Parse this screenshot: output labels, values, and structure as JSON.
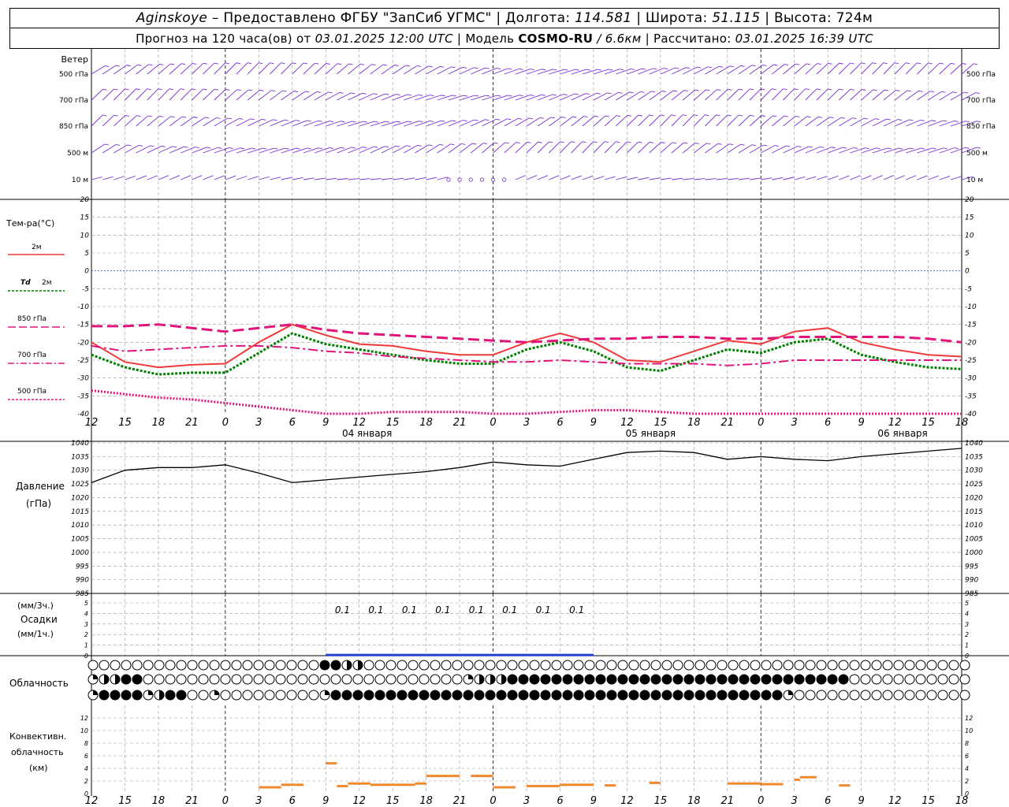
{
  "header": {
    "line1": {
      "station": "Aginskoye",
      "provider": " – Предоставлено ФГБУ \"ЗапСиб УГМС\" | Долгота: ",
      "lon": "114.581",
      "lat_label": " | Широта: ",
      "lat": "51.115",
      "alt_label": " | Высота: ",
      "alt": "724м"
    },
    "line2": {
      "forecast_label": "Прогноз на 120 часа(ов) от ",
      "forecast_from": "03.01.2025 12:00 UTC",
      "model_label": " | Модель ",
      "model": "COSMO-RU",
      "resolution": " / 6.6км",
      "calc_label": " | Рассчитано: ",
      "calc_time": "03.01.2025 16:39 UTC"
    }
  },
  "colors": {
    "wind": "#7a2ed6",
    "t2m": "#f03a3a",
    "td2m": "#008000",
    "t850": "#e0157a",
    "t700": "#e0157a",
    "t500": "#e0157a",
    "zero_line": "#3050e0",
    "pressure": "#000000",
    "precip": "#2040d0",
    "convective": "#f08a30",
    "grid": "#9a9a9a"
  },
  "labels": {
    "wind_title": "Ветер",
    "wind_levels": [
      "500 гПа",
      "700 гПа",
      "850 гПа",
      "500 м",
      "10 м"
    ],
    "temp_title": "Тем-ра(°C)",
    "t2m_label": "2м",
    "td_label": "Td",
    "td_level": "2м",
    "t850_label": "850 гПа",
    "t700_label": "700 гПа",
    "t500_label": "500 гПа",
    "pressure_title": "Давление",
    "pressure_unit": "(гПа)",
    "precip_unit_3h": "(мм/3ч.)",
    "precip_title": "Осадки",
    "precip_unit_1h": "(мм/1ч.)",
    "cloud_title": "Облачность",
    "conv_title1": "Конвективн.",
    "conv_title2": "облачность",
    "conv_unit": "(км)"
  },
  "time_axis": {
    "ticks": [
      "12",
      "15",
      "18",
      "21",
      "0",
      "3",
      "6",
      "9",
      "12",
      "15",
      "18",
      "21",
      "0",
      "3",
      "6",
      "9",
      "12",
      "15",
      "18",
      "21",
      "0",
      "3",
      "6",
      "9",
      "12",
      "15",
      "18"
    ],
    "dates": [
      "04 января",
      "05 января",
      "06 января"
    ]
  },
  "chart_data": [
    {
      "type": "line",
      "title": "Тем-ра(°C)",
      "ylim": [
        -40,
        20
      ],
      "yticks": [
        "20",
        "15",
        "10",
        "5",
        "0",
        "-5",
        "-10",
        "-15",
        "-20",
        "-25",
        "-30",
        "-35",
        "-40"
      ],
      "x_hours": [
        0,
        3,
        6,
        9,
        12,
        15,
        18,
        21,
        24,
        27,
        30,
        33,
        36,
        39,
        42,
        45,
        48,
        51,
        54,
        57,
        60,
        63,
        66,
        69,
        72,
        75,
        78
      ],
      "series": [
        {
          "name": "2м",
          "values": [
            -20,
            -25.5,
            -27,
            -26.3,
            -26,
            -20,
            -15,
            -18,
            -20.5,
            -21,
            -22.5,
            -23.5,
            -23.5,
            -20,
            -17.5,
            -20,
            -25,
            -25.5,
            -22.5,
            -19.5,
            -20.5,
            -17,
            -16,
            -20,
            -22,
            -23.5,
            -24
          ]
        },
        {
          "name": "Td 2м",
          "values": [
            -23.5,
            -27,
            -29,
            -28.5,
            -28.5,
            -23,
            -17.5,
            -20.5,
            -22,
            -23.5,
            -25,
            -26,
            -26,
            -22,
            -20,
            -22.5,
            -27,
            -28,
            -25,
            -22,
            -23,
            -20,
            -19,
            -23.5,
            -25.5,
            -27,
            -27.5
          ]
        },
        {
          "name": "850 гПа",
          "values": [
            -15.5,
            -15.5,
            -15,
            -16,
            -17,
            -16,
            -15,
            -16.5,
            -17.5,
            -18,
            -18.5,
            -19,
            -19.5,
            -20,
            -19.5,
            -19,
            -19,
            -18.5,
            -18.5,
            -19,
            -19,
            -18.5,
            -18.5,
            -18.5,
            -18.5,
            -19,
            -20
          ]
        },
        {
          "name": "700 гПа",
          "values": [
            -21,
            -22.5,
            -22,
            -21.5,
            -21,
            -21,
            -21.5,
            -22.5,
            -23,
            -24,
            -24.5,
            -25,
            -25.5,
            -25.5,
            -25,
            -25.5,
            -26,
            -26,
            -26,
            -26.5,
            -26,
            -25,
            -25,
            -25,
            -25,
            -25,
            -25
          ]
        },
        {
          "name": "500 гПа",
          "values": [
            -33.5,
            -34.5,
            -35.5,
            -36,
            -37,
            -38,
            -39,
            -40,
            -40,
            -39.5,
            -39.5,
            -39.5,
            -40,
            -40,
            -39.5,
            -39,
            -39,
            -39.5,
            -40,
            -40.5,
            -40,
            -40,
            -40.5,
            -41,
            -41,
            -41,
            -41
          ]
        }
      ]
    },
    {
      "type": "line",
      "title": "Давление",
      "ylabel": "(гПа)",
      "ylim": [
        985,
        1040
      ],
      "yticks": [
        "1040",
        "1035",
        "1030",
        "1025",
        "1020",
        "1015",
        "1010",
        "1005",
        "1000",
        "995",
        "990",
        "985"
      ],
      "x_hours": [
        0,
        3,
        6,
        9,
        12,
        15,
        18,
        21,
        24,
        27,
        30,
        33,
        36,
        39,
        42,
        45,
        48,
        51,
        54,
        57,
        60,
        63,
        66,
        69,
        72,
        75,
        78
      ],
      "series": [
        {
          "name": "Давление",
          "values": [
            1025.5,
            1030,
            1031,
            1031,
            1032,
            1029,
            1025.5,
            1026.5,
            1027.5,
            1028.5,
            1029.5,
            1031,
            1033,
            1032,
            1031.5,
            1034,
            1036.5,
            1037,
            1036.5,
            1034,
            1035,
            1034,
            1033.5,
            1035,
            1036,
            1037,
            1038
          ]
        }
      ]
    },
    {
      "type": "bar",
      "title": "Осадки",
      "ylim": [
        0,
        5
      ],
      "yticks": [
        "5",
        "4",
        "3",
        "2",
        "1",
        "0"
      ],
      "amount_labels": [
        "0.1",
        "0.1",
        "0.1",
        "0.1",
        "0.1",
        "0.1",
        "0.1",
        "0.1"
      ],
      "x_hours": [
        21,
        24,
        27,
        30,
        33,
        36,
        39,
        42
      ],
      "values": [
        0.1,
        0.1,
        0.1,
        0.1,
        0.1,
        0.1,
        0.1,
        0.1
      ]
    },
    {
      "type": "table",
      "title": "Облачность",
      "rows": {
        "upper": "0000000000000000000003322000000000000000000000000000000000000000000000000000000000",
        "middle": "1223300000000000000000000000000000122233333333333333333333333333333330000000000000",
        "lower": "1333312330010000000001333333333333333333333333333333333333333331000000000000000000"
      }
    },
    {
      "type": "bar",
      "title": "Конвективн. облачность",
      "ylabel": "(км)",
      "ylim": [
        0,
        14
      ],
      "yticks": [
        "12",
        "10",
        "8",
        "6",
        "4",
        "2",
        "0"
      ],
      "segments": [
        [
          15,
          17,
          1
        ],
        [
          17,
          19,
          1.4
        ],
        [
          21,
          22,
          4.8
        ],
        [
          22,
          23,
          1.2
        ],
        [
          23,
          25,
          1.6
        ],
        [
          25,
          29,
          1.4
        ],
        [
          29,
          30,
          1.6
        ],
        [
          30,
          33,
          2.8
        ],
        [
          34,
          36,
          2.8
        ],
        [
          36,
          38,
          1
        ],
        [
          39,
          42,
          1.2
        ],
        [
          42,
          45,
          1.4
        ],
        [
          46,
          47,
          1.3
        ],
        [
          50,
          51,
          1.7
        ],
        [
          57,
          60,
          1.6
        ],
        [
          60,
          62,
          1.5
        ],
        [
          63,
          63.5,
          2.2
        ],
        [
          63.5,
          65,
          2.6
        ],
        [
          67,
          68,
          1.3
        ]
      ]
    }
  ]
}
